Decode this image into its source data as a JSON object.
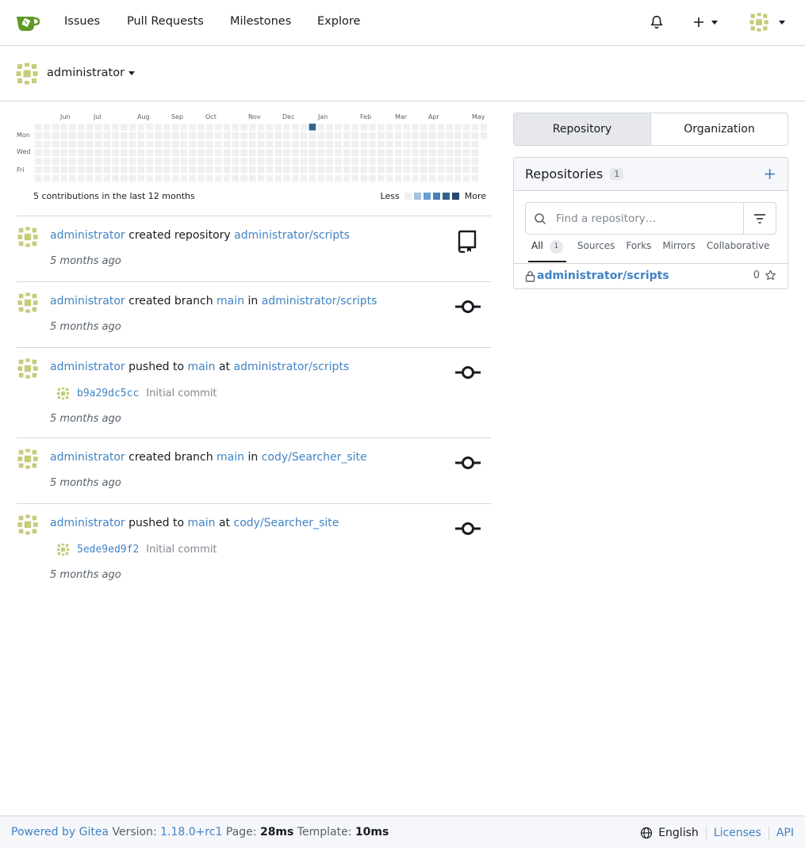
{
  "nav": {
    "links": [
      "Issues",
      "Pull Requests",
      "Milestones",
      "Explore"
    ]
  },
  "profile": {
    "name": "administrator"
  },
  "heatmap": {
    "months": [
      "Jun",
      "Jul",
      "Aug",
      "Sep",
      "Oct",
      "Nov",
      "Dec",
      "Jan",
      "Feb",
      "Mar",
      "Apr",
      "May"
    ],
    "days": [
      "Mon",
      "Wed",
      "Fri"
    ],
    "summary": "5 contributions in the last 12 months",
    "legend_less": "Less",
    "legend_more": "More",
    "colors": [
      "#eef0f2",
      "#a4c1df",
      "#6a9fd0",
      "#4a7fb8",
      "#34618f",
      "#254a6e"
    ],
    "active_color": "#34618f"
  },
  "feed": [
    {
      "user": "administrator",
      "action": "created repository",
      "mid": "",
      "ref": "",
      "target": "administrator/scripts",
      "time": "5 months ago",
      "icon": "repo-icon"
    },
    {
      "user": "administrator",
      "action": "created branch",
      "ref": "main",
      "mid": "in",
      "target": "administrator/scripts",
      "time": "5 months ago",
      "icon": "commit-icon"
    },
    {
      "user": "administrator",
      "action": "pushed to",
      "ref": "main",
      "mid": "at",
      "target": "administrator/scripts",
      "commit_sha": "b9a29dc5cc",
      "commit_msg": "Initial commit",
      "time": "5 months ago",
      "icon": "commit-icon"
    },
    {
      "user": "administrator",
      "action": "created branch",
      "ref": "main",
      "mid": "in",
      "target": "cody/Searcher_site",
      "time": "5 months ago",
      "icon": "commit-icon"
    },
    {
      "user": "administrator",
      "action": "pushed to",
      "ref": "main",
      "mid": "at",
      "target": "cody/Searcher_site",
      "commit_sha": "5ede9ed9f2",
      "commit_msg": "Initial commit",
      "time": "5 months ago",
      "icon": "commit-icon"
    }
  ],
  "panel": {
    "tabs": [
      "Repository",
      "Organization"
    ],
    "repos_title": "Repositories",
    "repos_count": "1",
    "add_label": "+",
    "search_placeholder": "Find a repository…",
    "sub_tabs": [
      "All",
      "Sources",
      "Forks",
      "Mirrors",
      "Collaborative"
    ],
    "all_count": "1",
    "repo_name": "administrator/scripts",
    "repo_stars": "0"
  },
  "footer": {
    "powered_by": "Powered by Gitea",
    "version_label": "Version:",
    "version": "1.18.0+rc1",
    "page_label": "Page:",
    "page_time": "28ms",
    "template_label": "Template:",
    "template_time": "10ms",
    "language": "English",
    "licenses": "Licenses",
    "api": "API"
  }
}
